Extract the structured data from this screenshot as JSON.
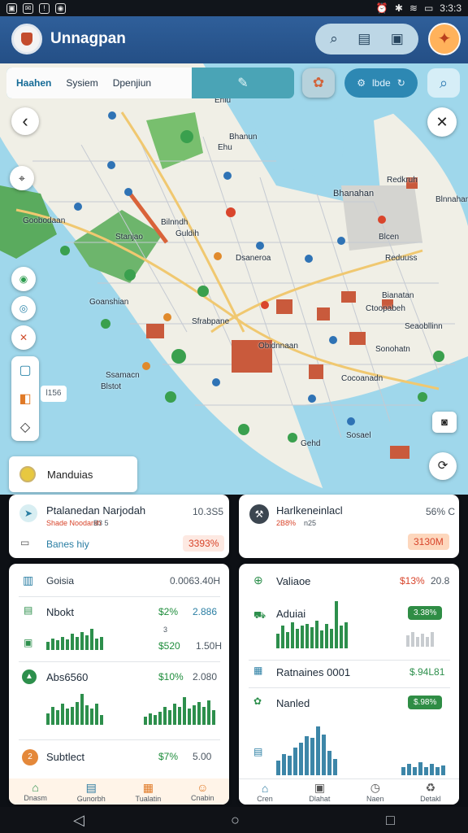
{
  "status": {
    "icons_left": [
      "photo-icon",
      "mail-icon",
      "alert-icon",
      "wifi-icon"
    ],
    "time": "3:3:3"
  },
  "header": {
    "title": "Unnagpan",
    "actions": [
      "search-icon",
      "document-icon",
      "image-icon"
    ]
  },
  "tabs": {
    "items": [
      "Haahen",
      "Sysiem",
      "Dpenjiun"
    ],
    "accent": "#146a96"
  },
  "map_buttons": {
    "pill_text": "lbde",
    "back": "‹",
    "close": "✕"
  },
  "map_labels": [
    "Ehlu",
    "Ehu",
    "Bhanun",
    "Bhanahan",
    "Blnnahan",
    "Goobodaan",
    "Bilnndh",
    "Guldih",
    "Stanjao",
    "Blcen",
    "Dsaneroa",
    "Reduuss",
    "Goanshian",
    "Ctoopabeh",
    "Sfrabpane",
    "Obidnnaan",
    "Seaobllinn",
    "Ssamacn",
    "Cocoanadn",
    "Sonohatn",
    "Bianatan",
    "Blstot",
    "Gehd",
    "Sosael",
    "Redkruh"
  ],
  "side_tools": {
    "hash": "l156"
  },
  "popup": {
    "label": "Manduias"
  },
  "cards": {
    "top_left": {
      "title": "Ptalanedan Narjodah",
      "sub": "Shade Noodarsh",
      "sub2": "B3 5",
      "value": "10.3S5",
      "type_text": "Banes hiy",
      "badge": "3393%"
    },
    "top_right": {
      "title": "Harlkeneinlacl",
      "sub": "2B8%",
      "sub2": "n25",
      "value": "56% C",
      "badge": "3130M"
    },
    "lower_left": {
      "title": "Goisia",
      "value": "0.0063.40H",
      "rows": [
        {
          "label": "Nbokt",
          "pct": "$2%",
          "val": "2.886",
          "sub": "$520",
          "sub_val": "1.50H",
          "mid": "3"
        },
        {
          "label": "Abs6560",
          "pct": "$10%",
          "val": "2.080"
        },
        {
          "label": "Subtlect",
          "pct": "$7%",
          "val": "5.00"
        }
      ],
      "nav": [
        "Dnasm",
        "Gunorbh",
        "Tualatin",
        "Cnabin"
      ]
    },
    "lower_right": {
      "title": "Valiaoe",
      "pct": "$13%",
      "val": "20.8",
      "rows": [
        {
          "label": "Aduiai",
          "badge": "3.38%"
        },
        {
          "label": "Ratnaines 0001",
          "badge": "$.94L81"
        },
        {
          "label": "Nanled",
          "badge": "$.98%"
        }
      ],
      "nav": [
        "Cren",
        "Dlahat",
        "Naen",
        "Detakl"
      ]
    }
  },
  "sys_nav": {
    "back": "◁",
    "home": "○",
    "recent": "□"
  }
}
